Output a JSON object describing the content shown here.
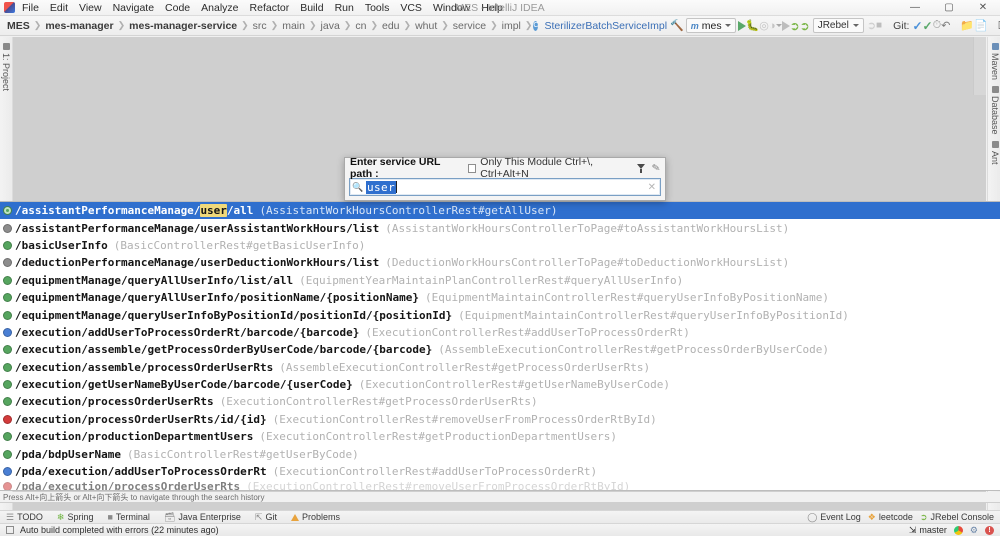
{
  "window": {
    "title": "MES - IntelliJ IDEA",
    "minimize": "—",
    "maximize": "▢",
    "close": "✕"
  },
  "menu": [
    "File",
    "Edit",
    "View",
    "Navigate",
    "Code",
    "Analyze",
    "Refactor",
    "Build",
    "Run",
    "Tools",
    "VCS",
    "Window",
    "Help"
  ],
  "breadcrumb": {
    "items": [
      "MES",
      "mes-manager",
      "mes-manager-service",
      "src",
      "main",
      "java",
      "cn",
      "edu",
      "whut",
      "service",
      "impl"
    ],
    "class_name": "SterilizerBatchServiceImpl",
    "class_icon": "C"
  },
  "toolbar": {
    "run_config": "mes",
    "run_config_icon": "m",
    "jrebel_label": "JRebel",
    "git_label": "Git:",
    "icons": [
      "hammer-icon",
      "run-icon",
      "debug-icon",
      "run-with-coverage-icon",
      "profile-icon",
      "jrebel-run-icon",
      "jrebel-debug-icon",
      "stop-icon",
      "update-project-icon",
      "commit-icon",
      "history-icon",
      "rollback-icon",
      "open-folder-icon",
      "settings-sync-icon",
      "layout-icon",
      "search-everywhere-icon"
    ]
  },
  "left_strip": {
    "items": [
      "1: Project"
    ]
  },
  "right_strip": {
    "items": [
      "Maven",
      "Database",
      "Ant"
    ]
  },
  "search_popup": {
    "title": "Enter service URL path :",
    "module_option": "Only This Module Ctrl+\\, Ctrl+Alt+N",
    "module_checked": false,
    "filter_icon": "filter-icon",
    "edit_icon": "pencil-icon",
    "search_icon": "search-icon",
    "clear_icon": "clear-icon",
    "query": "user",
    "placeholder": "Enter service URL path"
  },
  "hint": "Press Alt+向上箭头 or Alt+向下箭头 to navigate through the search history",
  "results": [
    {
      "method": "get",
      "ring": true,
      "pre": "/assistantPerformanceManage/",
      "hl": "user",
      "post": "/all",
      "meta": "(AssistantWorkHoursControllerRest#getAllUser)",
      "selected": true
    },
    {
      "method": "gray",
      "pre": "/assistantPerformanceManage/userAssistantWorkHours/list",
      "hl": "",
      "post": "",
      "meta": "(AssistantWorkHoursControllerToPage#toAssistantWorkHoursList)",
      "selected": false
    },
    {
      "method": "get",
      "pre": "/basicUserInfo",
      "hl": "",
      "post": "",
      "meta": "(BasicControllerRest#getBasicUserInfo)",
      "selected": false
    },
    {
      "method": "gray",
      "pre": "/deductionPerformanceManage/userDeductionWorkHours/list",
      "hl": "",
      "post": "",
      "meta": "(DeductionWorkHoursControllerToPage#toDeductionWorkHoursList)",
      "selected": false
    },
    {
      "method": "get",
      "pre": "/equipmentManage/queryAllUserInfo/list/all",
      "hl": "",
      "post": "",
      "meta": "(EquipmentYearMaintainPlanControllerRest#queryAllUserInfo)",
      "selected": false
    },
    {
      "method": "get",
      "pre": "/equipmentManage/queryAllUserInfo/positionName/{positionName}",
      "hl": "",
      "post": "",
      "meta": "(EquipmentMaintainControllerRest#queryUserInfoByPositionName)",
      "selected": false
    },
    {
      "method": "get",
      "pre": "/equipmentManage/queryUserInfoByPositionId/positionId/{positionId}",
      "hl": "",
      "post": "",
      "meta": "(EquipmentMaintainControllerRest#queryUserInfoByPositionId)",
      "selected": false
    },
    {
      "method": "post",
      "pre": "/execution/addUserToProcessOrderRt/barcode/{barcode}",
      "hl": "",
      "post": "",
      "meta": "(ExecutionControllerRest#addUserToProcessOrderRt)",
      "selected": false
    },
    {
      "method": "get",
      "pre": "/execution/assemble/getProcessOrderByUserCode/barcode/{barcode}",
      "hl": "",
      "post": "",
      "meta": "(AssembleExecutionControllerRest#getProcessOrderByUserCode)",
      "selected": false
    },
    {
      "method": "get",
      "pre": "/execution/assemble/processOrderUserRts",
      "hl": "",
      "post": "",
      "meta": "(AssembleExecutionControllerRest#getProcessOrderUserRts)",
      "selected": false
    },
    {
      "method": "get",
      "pre": "/execution/getUserNameByUserCode/barcode/{userCode}",
      "hl": "",
      "post": "",
      "meta": "(ExecutionControllerRest#getUserNameByUserCode)",
      "selected": false
    },
    {
      "method": "get",
      "pre": "/execution/processOrderUserRts",
      "hl": "",
      "post": "",
      "meta": "(ExecutionControllerRest#getProcessOrderUserRts)",
      "selected": false
    },
    {
      "method": "del",
      "pre": "/execution/processOrderUserRts/id/{id}",
      "hl": "",
      "post": "",
      "meta": "(ExecutionControllerRest#removeUserFromProcessOrderRtById)",
      "selected": false
    },
    {
      "method": "get",
      "pre": "/execution/productionDepartmentUsers",
      "hl": "",
      "post": "",
      "meta": "(ExecutionControllerRest#getProductionDepartmentUsers)",
      "selected": false
    },
    {
      "method": "get",
      "pre": "/pda/bdpUserName",
      "hl": "",
      "post": "",
      "meta": "(BasicControllerRest#getUserByCode)",
      "selected": false
    },
    {
      "method": "post",
      "pre": "/pda/execution/addUserToProcessOrderRt",
      "hl": "",
      "post": "",
      "meta": "(ExecutionControllerRest#addUserToProcessOrderRt)",
      "selected": false
    },
    {
      "method": "del",
      "pre": "/pda/execution/processOrderUserRts",
      "hl": "",
      "post": "",
      "meta": "(ExecutionControllerRest#removeUserFromProcessOrderRtById)",
      "selected": false,
      "cut": true
    }
  ],
  "tool_windows": [
    {
      "label": "TODO",
      "icon": "todo-icon"
    },
    {
      "label": "Spring",
      "icon": "spring-icon"
    },
    {
      "label": "Terminal",
      "icon": "terminal-icon"
    },
    {
      "label": "Java Enterprise",
      "icon": "java-enterprise-icon"
    },
    {
      "label": "Git",
      "icon": "git-icon"
    },
    {
      "label": "Problems",
      "icon": "warning-icon"
    }
  ],
  "tool_windows_right": [
    {
      "label": "Event Log",
      "icon": "event-log-icon"
    },
    {
      "label": "leetcode",
      "icon": "leetcode-icon"
    },
    {
      "label": "JRebel Console",
      "icon": "jrebel-icon"
    }
  ],
  "status": {
    "message": "Auto build completed with errors (22 minutes ago)",
    "branch": "master",
    "branch_icon": "branch-icon",
    "browser_icon": "chrome-icon",
    "plugin_icon": "plugin-icon",
    "error_icon": "error-icon",
    "error_count": "!"
  },
  "colors": {
    "selection": "#2f6fce",
    "highlight": "#f6e8a0",
    "get": "#56a55f",
    "post": "#4a7fd4",
    "delete": "#d33b3b"
  }
}
